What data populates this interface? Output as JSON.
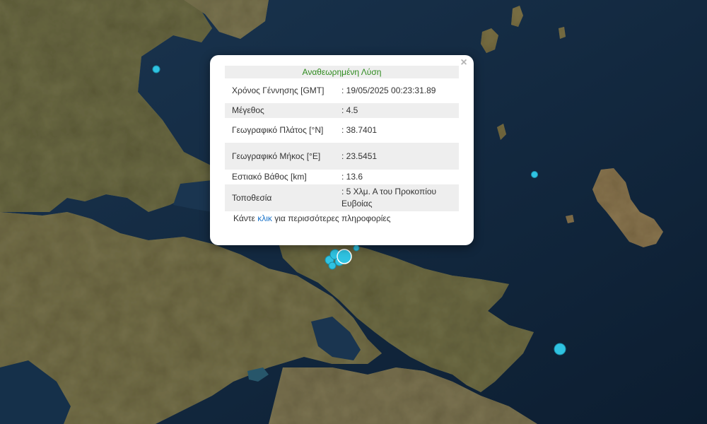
{
  "popup": {
    "title": "Αναθεωρημένη Λύση",
    "rows": [
      {
        "label": "Χρόνος Γέννησης [GMT]",
        "value": ": 19/05/2025 00:23:31.89"
      },
      {
        "label": "Μέγεθος",
        "value": ": 4.5"
      },
      {
        "label": "Γεωγραφικό Πλάτος [°N]",
        "value": ": 38.7401"
      },
      {
        "label": "Γεωγραφικό Μήκος [°E]",
        "value": ": 23.5451"
      },
      {
        "label": "Εστιακό Βάθος [km]",
        "value": ": 13.6"
      },
      {
        "label": "Τοποθεσία",
        "value": ": 5 Χλμ. Α του Προκοπίου Ευβοίας"
      }
    ],
    "more_prefix": "Κάντε",
    "more_link": "κλικ",
    "more_suffix": "για περισσότερες πληροφορίες",
    "close": "×"
  },
  "markers_color": "#2fc3e2"
}
